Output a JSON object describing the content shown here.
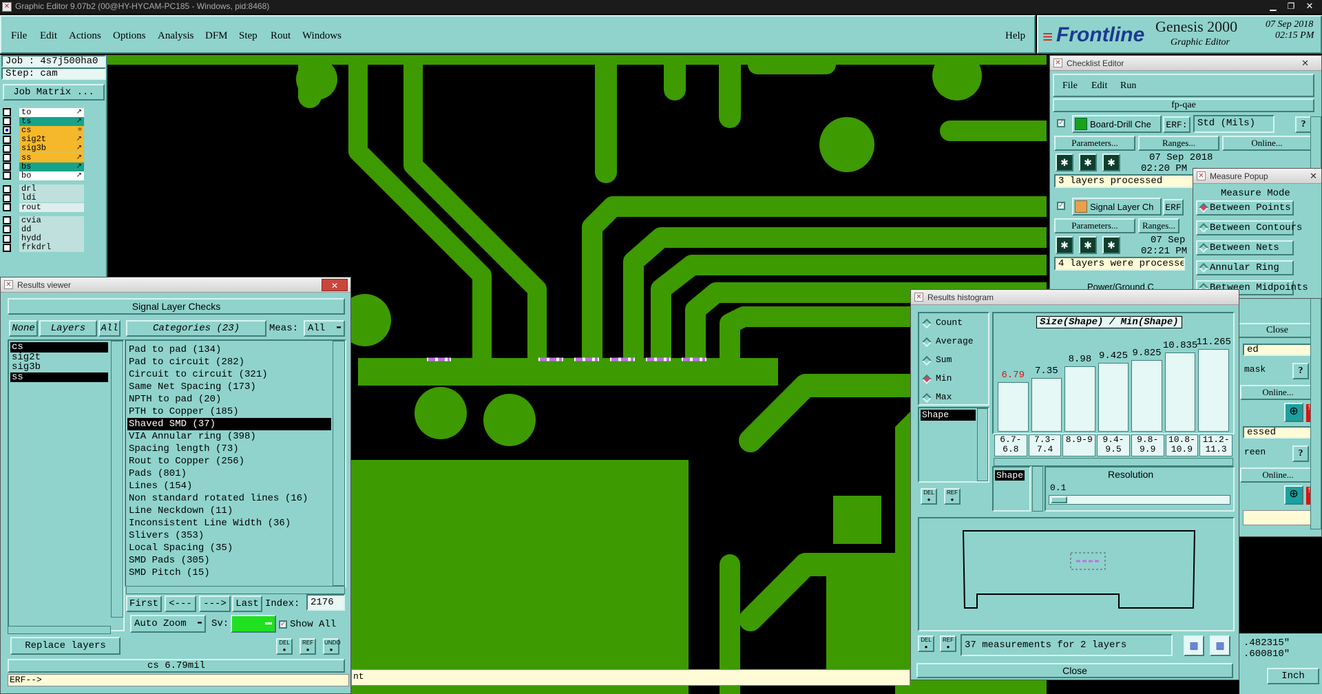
{
  "window": {
    "title": "Graphic Editor 9.07b2 (00@HY-HYCAM-PC185 - Windows, pid:8468)"
  },
  "menu": {
    "items": [
      "File",
      "Edit",
      "Actions",
      "Options",
      "Analysis",
      "DFM",
      "Step",
      "Rout",
      "Windows"
    ],
    "help": "Help"
  },
  "brand": {
    "name": "Frontline",
    "product": "Genesis 2000",
    "subtitle": "Graphic Editor",
    "date": "07 Sep 2018",
    "time": "02:15 PM"
  },
  "job": {
    "job_label": "Job : 4s7j500ha0",
    "step_label": "Step: cam",
    "matrix_button": "Job Matrix ..."
  },
  "layers": {
    "group1": [
      {
        "name": "to",
        "color": "#ffffff",
        "mark": "↗"
      },
      {
        "name": "ts",
        "color": "#17a38a",
        "mark": "↗"
      },
      {
        "name": "cs",
        "color": "#f6b82b",
        "mark": "="
      },
      {
        "name": "sig2t",
        "color": "#f6b82b",
        "mark": "↗"
      },
      {
        "name": "sig3b",
        "color": "#f6b82b",
        "mark": "↗"
      },
      {
        "name": "ss",
        "color": "#f6b82b",
        "mark": "↗"
      },
      {
        "name": "bs",
        "color": "#17a38a",
        "mark": "↗"
      },
      {
        "name": "bo",
        "color": "#ffffff",
        "mark": "↗"
      }
    ],
    "group2": [
      {
        "name": "drl",
        "color": "#bfe0dd"
      },
      {
        "name": "ldi",
        "color": "#bfe0dd"
      },
      {
        "name": "rout",
        "color": "#dfeeed"
      }
    ],
    "group3": [
      {
        "name": "cvia",
        "color": "#bfe0dd"
      },
      {
        "name": "dd",
        "color": "#bfe0dd"
      },
      {
        "name": "hydd",
        "color": "#bfe0dd"
      },
      {
        "name": "frkdrl",
        "color": "#bfe0dd"
      }
    ]
  },
  "results_viewer": {
    "title": "Results viewer",
    "header": "Signal Layer Checks",
    "none": "None",
    "layers": "Layers",
    "all": "All",
    "categories_label": "Categories (23)",
    "meas_label": "Meas:",
    "meas_value": "All",
    "layer_list": [
      "cs",
      "sig2t",
      "sig3b",
      "ss"
    ],
    "categories": [
      "Pad to pad (134)",
      "Pad to circuit (282)",
      "Circuit to circuit (321)",
      "Same Net Spacing (173)",
      "NPTH to pad (20)",
      "PTH to Copper (185)",
      "Shaved SMD (37)",
      "VIA Annular ring (398)",
      "Spacing length (73)",
      "Rout to Copper (256)",
      "Pads (801)",
      "Lines (154)",
      "Non standard rotated lines (16)",
      "Line Neckdown (11)",
      "Inconsistent Line Width (36)",
      "Slivers (353)",
      "Local Spacing (35)",
      "SMD Pads (305)",
      "SMD Pitch (15)"
    ],
    "selected_category": 6,
    "first": "First",
    "prev": "<---",
    "next": "--->",
    "last": "Last",
    "index_label": "Index:",
    "index_value": "2176",
    "auto_zoom": "Auto Zoom",
    "sv_label": "Sv:",
    "show_all": "Show All",
    "replace_layers": "Replace layers",
    "status": "cs 6.79mil",
    "cmd": "ERF-->"
  },
  "checklist": {
    "title": "Checklist Editor",
    "menu": [
      "File",
      "Edit",
      "Run"
    ],
    "name": "fp-qae",
    "check1": {
      "name": "Board-Drill Che",
      "erf": "ERF:",
      "std": "Std (Mils)",
      "date": "07 Sep 2018",
      "time": "02:20 PM -",
      "status": "3 layers processed"
    },
    "check2": {
      "name": "Signal Layer Ch",
      "erf": "ERF",
      "date": "07 Sep",
      "time": "02:21 PM -",
      "status": "4 layers were processe"
    },
    "check3": {
      "name": "Power/Ground C"
    },
    "parameters": "Parameters...",
    "ranges": "Ranges...",
    "online": "Online...",
    "help": "?",
    "right_texts": [
      "Close",
      "ed",
      "mask",
      "Online...",
      "essed",
      "reen",
      "Online..."
    ]
  },
  "measure": {
    "title": "Measure Popup",
    "mode": "Measure Mode",
    "items": [
      "Between Points",
      "Between Contours",
      "Between Nets",
      "Annular Ring",
      "Between Midpoints"
    ]
  },
  "histogram": {
    "title": "Results histogram",
    "options": [
      "Count",
      "Average",
      "Sum",
      "Min",
      "Max"
    ],
    "selected_option": 3,
    "list": [
      "Shape"
    ],
    "chart_title": "Size(Shape) / Min(Shape)",
    "bars": [
      {
        "value": "6.79",
        "bin": "6.7-6.8",
        "level": 0.6,
        "highlight": true
      },
      {
        "value": "7.35",
        "bin": "7.3-7.4",
        "level": 0.65
      },
      {
        "value": "8.98",
        "bin": "8.9-9",
        "level": 0.79
      },
      {
        "value": "9.425",
        "bin": "9.4-9.5",
        "level": 0.83
      },
      {
        "value": "9.825",
        "bin": "9.8-9.9",
        "level": 0.87
      },
      {
        "value": "10.835",
        "bin": "10.8-10.9",
        "level": 0.96
      },
      {
        "value": "11.265",
        "bin": "11.2-11.3",
        "level": 1.0
      }
    ],
    "shape_label": "Shape",
    "resolution_label": "Resolution",
    "resolution_value": "0.1",
    "summary": "37 measurements for 2 layers",
    "close": "Close"
  },
  "bottom": {
    "coord_x": ".482315\"",
    "coord_y": ".600810\"",
    "units": "Inch",
    "erf_tail": "nt"
  },
  "colors": {
    "copper": "#3d9a00",
    "panel": "#8fd3cc",
    "highlight": "#f6b82b"
  }
}
